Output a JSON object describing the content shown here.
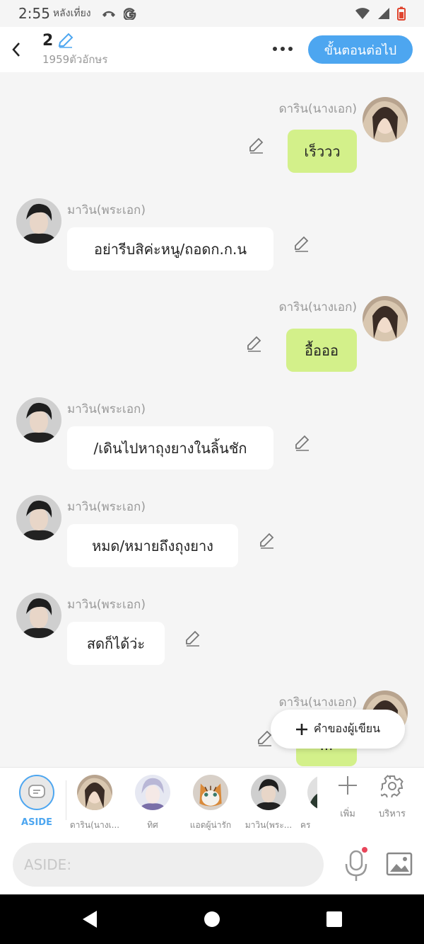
{
  "status": {
    "time": "2:55",
    "ampm": "หลังเที่ยง"
  },
  "header": {
    "chapter": "2",
    "char_count": "1959ตัวอักษร",
    "next_label": "ขั้นตอนต่อไป"
  },
  "messages": [
    {
      "side": "right",
      "name": "ดาริน(นางเอก)",
      "text": "เร็ววว"
    },
    {
      "side": "left",
      "name": "มาวิน(พระเอก)",
      "text": "อย่ารีบสิค่ะหนู/ถอดก.ก.น"
    },
    {
      "side": "right",
      "name": "ดาริน(นางเอก)",
      "text": "อื้อออ"
    },
    {
      "side": "left",
      "name": "มาวิน(พระเอก)",
      "text": "/เดินไปหาถุงยางในลิ้นชัก"
    },
    {
      "side": "left",
      "name": "มาวิน(พระเอก)",
      "text": "หมด/หมายถึงถุงยาง"
    },
    {
      "side": "left",
      "name": "มาวิน(พระเอก)",
      "text": "สดก็ได้ว่ะ"
    },
    {
      "side": "right",
      "name": "ดาริน(นางเอก)",
      "text": "..."
    }
  ],
  "writer_note": {
    "label": "คำของผู้เขียน"
  },
  "characters": {
    "aside": "ASIDE",
    "list": [
      "ดาริน(นางเ...",
      "ทิศ",
      "แอดผู้น่ารัก",
      "มาวิน(พระ...",
      "คร"
    ],
    "add_label": "เพิ่ม",
    "manage_label": "บริหาร"
  },
  "input": {
    "placeholder": "ASIDE:"
  },
  "colors": {
    "accent": "#4da6f0",
    "bubble_right": "#d3f08a",
    "bubble_left": "#ffffff"
  }
}
